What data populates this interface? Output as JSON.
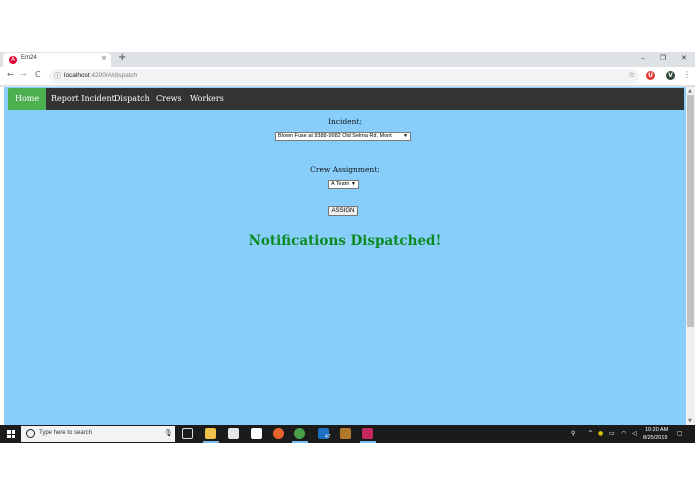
{
  "browser": {
    "tab_title": "Em24",
    "tab_close": "×",
    "new_tab": "+",
    "minimize": "–",
    "restore": "❐",
    "close": "✕",
    "back": "←",
    "forward": "→",
    "reload": "C",
    "url_host": "localhost",
    "url_path": ":4200/#/dispatch",
    "menu": "⋮"
  },
  "nav": {
    "items": [
      "Home",
      "Report Incident",
      "Dispatch",
      "Crews",
      "Workers"
    ],
    "active": "Home"
  },
  "form": {
    "incident_label": "Incident:",
    "incident_value": "Blown Fuse at 9388-9982 Old Selma Rd, Mont",
    "crew_label": "Crew Assignment:",
    "crew_value": "A Team",
    "assign_label": "ASSIGN"
  },
  "notification": "Notifications Dispatched!",
  "taskbar": {
    "search_placeholder": "Type here to search",
    "mail_badge": "47",
    "time": "10:20 AM",
    "date": "8/25/2019"
  },
  "colors": {
    "page_background": "#87cefa",
    "navbar": "#333333",
    "nav_active": "#4caf50",
    "notification_text": "#0b8a22"
  }
}
